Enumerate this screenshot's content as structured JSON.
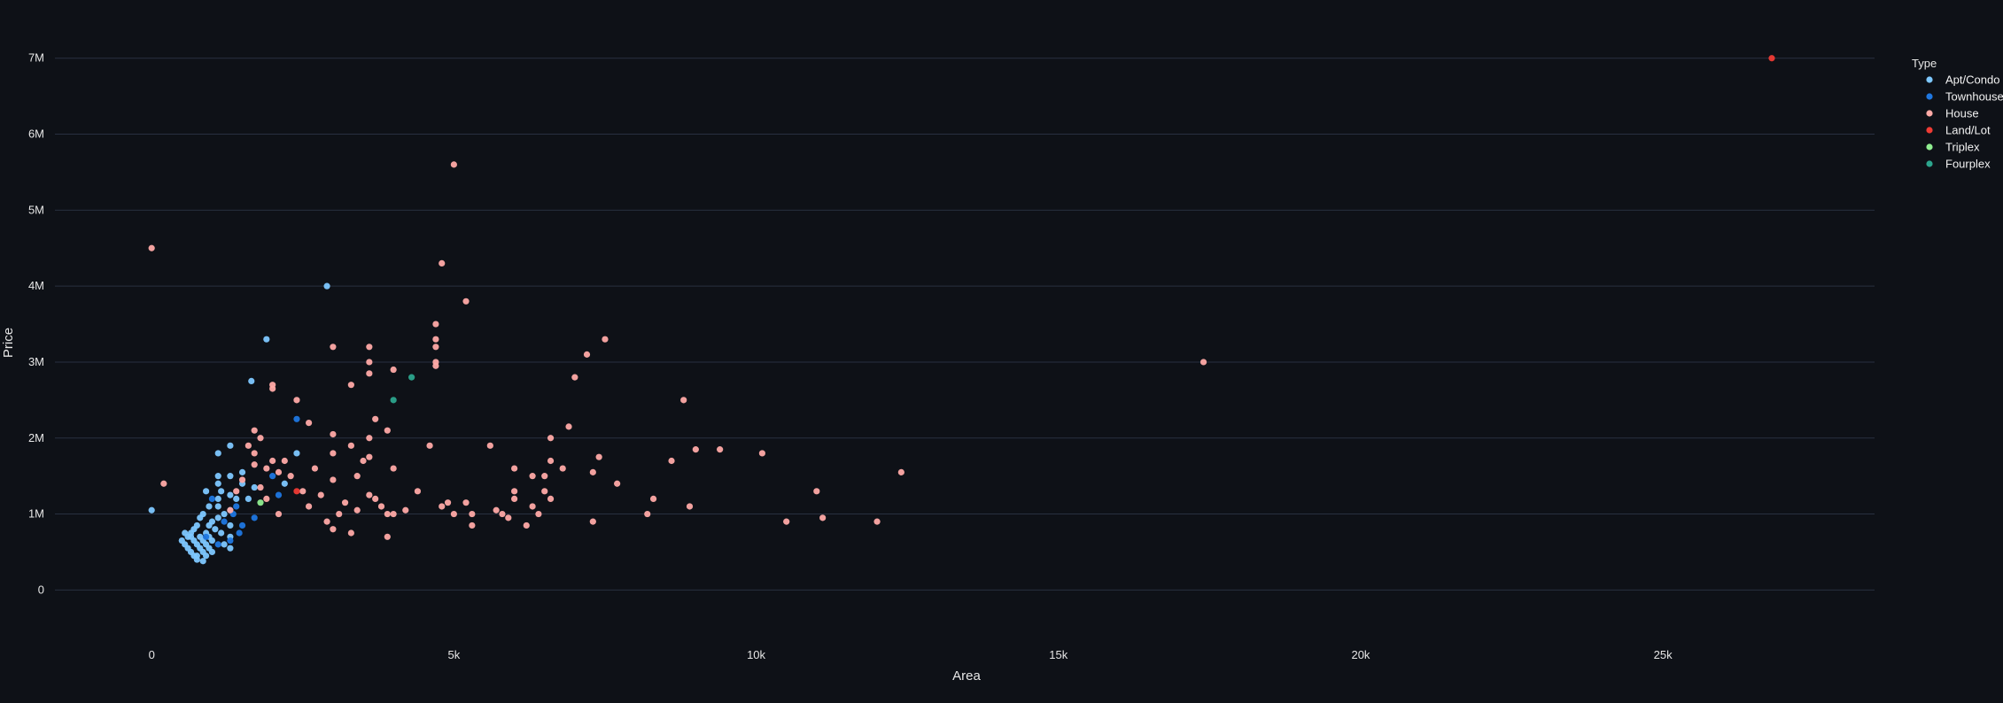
{
  "chart_data": {
    "type": "scatter",
    "xlabel": "Area",
    "ylabel": "Price",
    "legend_title": "Type",
    "legend_position": "top-right",
    "grid": "horizontal",
    "xlim": [
      -1600,
      28500
    ],
    "ylim": [
      -800000,
      7300000
    ],
    "x_ticks": [
      0,
      5000,
      10000,
      15000,
      20000,
      25000
    ],
    "x_tick_labels": [
      "0",
      "5k",
      "10k",
      "15k",
      "20k",
      "25k"
    ],
    "y_ticks": [
      0,
      1000000,
      2000000,
      3000000,
      4000000,
      5000000,
      6000000,
      7000000
    ],
    "y_tick_labels": [
      "0",
      "1M",
      "2M",
      "3M",
      "4M",
      "5M",
      "6M",
      "7M"
    ],
    "series": [
      {
        "name": "Apt/Condo",
        "color": "#7ec8ff",
        "points": [
          [
            0,
            1050000
          ],
          [
            500,
            650000
          ],
          [
            550,
            600000
          ],
          [
            600,
            700000
          ],
          [
            600,
            550000
          ],
          [
            650,
            750000
          ],
          [
            650,
            500000
          ],
          [
            700,
            800000
          ],
          [
            700,
            650000
          ],
          [
            700,
            450000
          ],
          [
            750,
            850000
          ],
          [
            750,
            600000
          ],
          [
            750,
            400000
          ],
          [
            800,
            700000
          ],
          [
            800,
            550000
          ],
          [
            800,
            950000
          ],
          [
            850,
            650000
          ],
          [
            850,
            500000
          ],
          [
            850,
            1000000
          ],
          [
            900,
            750000
          ],
          [
            900,
            450000
          ],
          [
            900,
            600000
          ],
          [
            900,
            1300000
          ],
          [
            950,
            850000
          ],
          [
            950,
            550000
          ],
          [
            950,
            700000
          ],
          [
            1000,
            900000
          ],
          [
            1000,
            650000
          ],
          [
            1000,
            500000
          ],
          [
            1050,
            800000
          ],
          [
            1100,
            1500000
          ],
          [
            1100,
            1400000
          ],
          [
            1100,
            1800000
          ],
          [
            1100,
            1200000
          ],
          [
            1100,
            1100000
          ],
          [
            1100,
            950000
          ],
          [
            1150,
            1300000
          ],
          [
            1150,
            750000
          ],
          [
            1200,
            600000
          ],
          [
            1200,
            1000000
          ],
          [
            1300,
            1900000
          ],
          [
            1300,
            1500000
          ],
          [
            1300,
            1250000
          ],
          [
            1300,
            1050000
          ],
          [
            1300,
            850000
          ],
          [
            1300,
            700000
          ],
          [
            1300,
            550000
          ],
          [
            1400,
            1200000
          ],
          [
            1500,
            1550000
          ],
          [
            1500,
            1400000
          ],
          [
            1600,
            1200000
          ],
          [
            1650,
            2750000
          ],
          [
            1700,
            1350000
          ],
          [
            1900,
            3300000
          ],
          [
            2200,
            1400000
          ],
          [
            2400,
            1800000
          ],
          [
            2900,
            4000000
          ],
          [
            750,
            450000
          ],
          [
            850,
            380000
          ],
          [
            650,
            700000
          ],
          [
            550,
            750000
          ],
          [
            950,
            1100000
          ]
        ]
      },
      {
        "name": "Townhouse",
        "color": "#1f77e0",
        "points": [
          [
            900,
            700000
          ],
          [
            1000,
            1200000
          ],
          [
            1100,
            600000
          ],
          [
            1200,
            900000
          ],
          [
            1300,
            650000
          ],
          [
            1350,
            1000000
          ],
          [
            1400,
            1100000
          ],
          [
            1450,
            750000
          ],
          [
            1500,
            850000
          ],
          [
            1700,
            950000
          ],
          [
            2000,
            1500000
          ],
          [
            2100,
            1250000
          ],
          [
            2400,
            2250000
          ]
        ]
      },
      {
        "name": "House",
        "color": "#ffaaa6",
        "points": [
          [
            0,
            4500000
          ],
          [
            200,
            1400000
          ],
          [
            1300,
            1050000
          ],
          [
            1400,
            1300000
          ],
          [
            1500,
            1450000
          ],
          [
            1600,
            1900000
          ],
          [
            1700,
            2100000
          ],
          [
            1700,
            1800000
          ],
          [
            1700,
            1650000
          ],
          [
            1800,
            2000000
          ],
          [
            1800,
            1350000
          ],
          [
            1900,
            1600000
          ],
          [
            1900,
            1200000
          ],
          [
            2000,
            2700000
          ],
          [
            2000,
            2650000
          ],
          [
            2000,
            1700000
          ],
          [
            2100,
            1550000
          ],
          [
            2100,
            1000000
          ],
          [
            2200,
            1700000
          ],
          [
            2300,
            1500000
          ],
          [
            2400,
            2500000
          ],
          [
            2500,
            1300000
          ],
          [
            2600,
            2200000
          ],
          [
            2600,
            1100000
          ],
          [
            2700,
            1600000
          ],
          [
            2800,
            1250000
          ],
          [
            2900,
            900000
          ],
          [
            3000,
            3200000
          ],
          [
            3000,
            2050000
          ],
          [
            3000,
            1800000
          ],
          [
            3000,
            1450000
          ],
          [
            3000,
            800000
          ],
          [
            3100,
            1000000
          ],
          [
            3200,
            1150000
          ],
          [
            3300,
            2700000
          ],
          [
            3300,
            1900000
          ],
          [
            3300,
            750000
          ],
          [
            3400,
            1500000
          ],
          [
            3400,
            1050000
          ],
          [
            3500,
            1700000
          ],
          [
            3600,
            3200000
          ],
          [
            3600,
            3000000
          ],
          [
            3600,
            2850000
          ],
          [
            3600,
            2000000
          ],
          [
            3600,
            1750000
          ],
          [
            3600,
            1250000
          ],
          [
            3700,
            1200000
          ],
          [
            3700,
            2250000
          ],
          [
            3800,
            1100000
          ],
          [
            3900,
            1000000
          ],
          [
            3900,
            2100000
          ],
          [
            3900,
            700000
          ],
          [
            4000,
            2900000
          ],
          [
            4000,
            1600000
          ],
          [
            4000,
            1000000
          ],
          [
            4200,
            1050000
          ],
          [
            4400,
            1300000
          ],
          [
            4600,
            1900000
          ],
          [
            4700,
            3500000
          ],
          [
            4700,
            3300000
          ],
          [
            4700,
            3200000
          ],
          [
            4700,
            3000000
          ],
          [
            4700,
            2950000
          ],
          [
            4800,
            4300000
          ],
          [
            4800,
            1100000
          ],
          [
            4900,
            1150000
          ],
          [
            5000,
            5600000
          ],
          [
            5000,
            1000000
          ],
          [
            5200,
            3800000
          ],
          [
            5200,
            1150000
          ],
          [
            5300,
            1000000
          ],
          [
            5300,
            850000
          ],
          [
            5600,
            1900000
          ],
          [
            5700,
            1050000
          ],
          [
            5800,
            1000000
          ],
          [
            5900,
            950000
          ],
          [
            6000,
            1600000
          ],
          [
            6000,
            1300000
          ],
          [
            6000,
            1200000
          ],
          [
            6200,
            850000
          ],
          [
            6300,
            1100000
          ],
          [
            6300,
            1500000
          ],
          [
            6400,
            1000000
          ],
          [
            6500,
            1500000
          ],
          [
            6500,
            1300000
          ],
          [
            6600,
            2000000
          ],
          [
            6600,
            1700000
          ],
          [
            6600,
            1200000
          ],
          [
            6800,
            1600000
          ],
          [
            6900,
            2150000
          ],
          [
            7000,
            2800000
          ],
          [
            7200,
            3100000
          ],
          [
            7300,
            1550000
          ],
          [
            7300,
            900000
          ],
          [
            7400,
            1750000
          ],
          [
            7500,
            3300000
          ],
          [
            7700,
            1400000
          ],
          [
            8200,
            1000000
          ],
          [
            8300,
            1200000
          ],
          [
            8600,
            1700000
          ],
          [
            8800,
            2500000
          ],
          [
            8900,
            1100000
          ],
          [
            9000,
            1850000
          ],
          [
            9400,
            1850000
          ],
          [
            10100,
            1800000
          ],
          [
            10500,
            900000
          ],
          [
            11000,
            1300000
          ],
          [
            11100,
            950000
          ],
          [
            12000,
            900000
          ],
          [
            12400,
            1550000
          ],
          [
            17400,
            3000000
          ]
        ]
      },
      {
        "name": "Land/Lot",
        "color": "#ef3b34",
        "points": [
          [
            2400,
            1300000
          ],
          [
            26800,
            7000000
          ]
        ]
      },
      {
        "name": "Triplex",
        "color": "#90ee90",
        "points": [
          [
            1800,
            1150000
          ]
        ]
      },
      {
        "name": "Fourplex",
        "color": "#2ca58d",
        "points": [
          [
            4000,
            2500000
          ],
          [
            4300,
            2800000
          ]
        ]
      }
    ]
  }
}
